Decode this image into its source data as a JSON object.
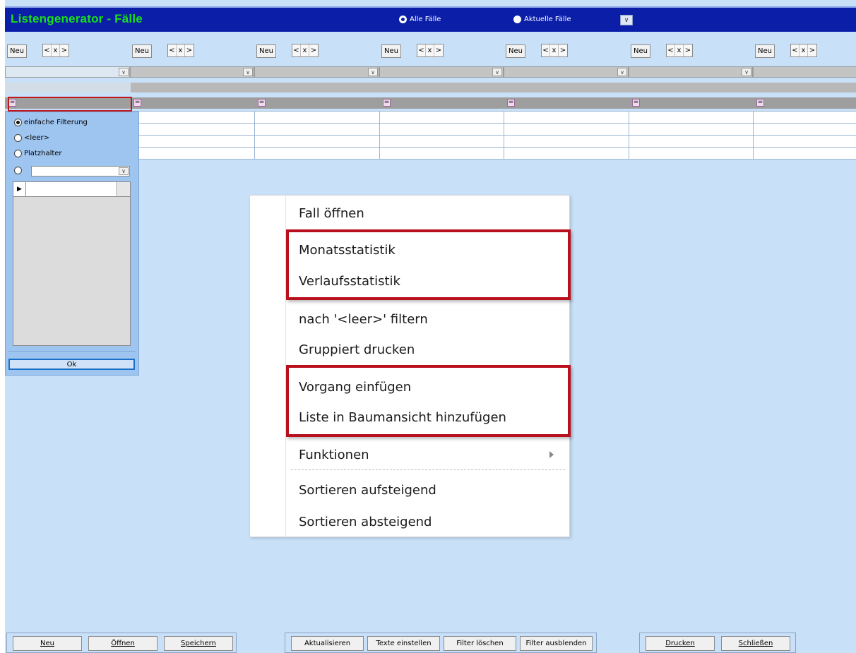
{
  "window": {
    "title": "Listengenerator - Fälle",
    "mode_options": [
      {
        "label": "Alle Fälle",
        "selected": true
      },
      {
        "label": "Aktuelle Fälle",
        "selected": false
      }
    ]
  },
  "columns": {
    "new_label": "Neu",
    "nav": [
      "<",
      "x",
      ">"
    ],
    "count": 7
  },
  "filter_panel": {
    "options": [
      {
        "label": "einfache Filterung",
        "selected": true
      },
      {
        "label": "<leer>",
        "selected": false
      },
      {
        "label": "Platzhalter",
        "selected": false
      },
      {
        "label": "",
        "selected": false
      }
    ],
    "ok_label": "Ok",
    "filter_operator": "="
  },
  "context_menu": {
    "items": [
      {
        "label": "Fall öffnen"
      },
      {
        "label": "Monatsstatistik"
      },
      {
        "label": "Verlaufsstatistik"
      },
      {
        "label": "nach '<leer>' filtern"
      },
      {
        "label": "Gruppiert drucken"
      },
      {
        "label": "Vorgang einfügen"
      },
      {
        "label": "Liste in Baumansicht hinzufügen"
      },
      {
        "label": "Funktionen",
        "submenu": true
      },
      {
        "label": "Sortieren aufsteigend"
      },
      {
        "label": "Sortieren absteigend"
      }
    ],
    "highlight_color": "#b8101c"
  },
  "bottom_bar": {
    "group1": [
      "Neu",
      "Öffnen",
      "Speichern"
    ],
    "group2": [
      "Aktualisieren",
      "Texte einstellen",
      "Filter löschen",
      "Filter ausblenden"
    ],
    "group3": [
      "Drucken",
      "Schließen"
    ]
  },
  "colors": {
    "title_bar": "#0a1ea8",
    "title_text": "#19e019",
    "background": "#c9e1f8"
  }
}
